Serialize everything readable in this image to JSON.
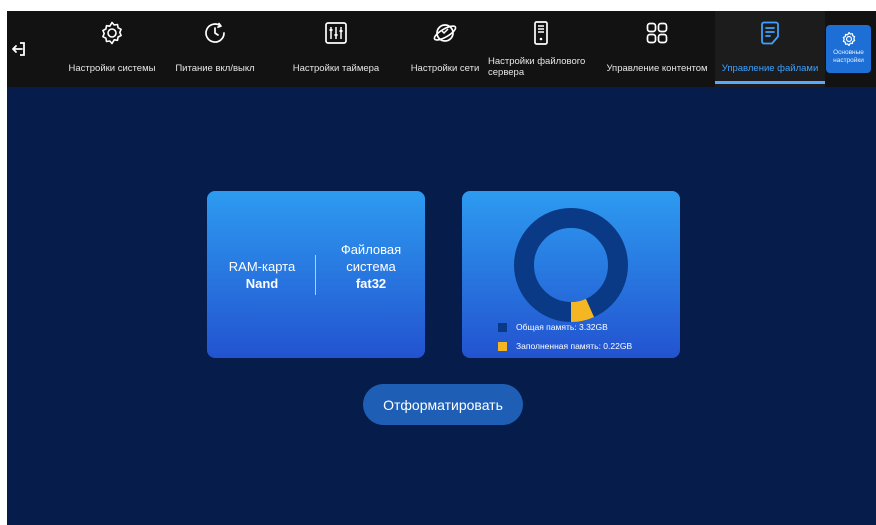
{
  "nav": {
    "tabs": [
      {
        "label": "Настройки системы",
        "icon": "gear-icon"
      },
      {
        "label": "Питание вкл/выкл",
        "icon": "power-timer-icon"
      },
      {
        "label": "Настройки таймера",
        "icon": "sliders-icon"
      },
      {
        "label": "Настройки сети",
        "icon": "network-globe-icon"
      },
      {
        "label": "Настройки файлового сервера",
        "icon": "file-server-icon"
      },
      {
        "label": "Управление контентом",
        "icon": "content-grid-icon"
      },
      {
        "label": "Управление файлами",
        "icon": "file-manage-icon",
        "active": true
      }
    ],
    "side_button": {
      "label": "Основные настройки",
      "icon": "gear-icon"
    },
    "back_icon": "exit-arrow-icon"
  },
  "storage_card": {
    "card_label": "RAM-карта",
    "card_value": "Nand",
    "fs_label": "Файловая система",
    "fs_value": "fat32"
  },
  "memory_card": {
    "total_label": "Общая память: 3.32GB",
    "used_label": "Заполненная память: 0.22GB",
    "total_gb": 3.32,
    "used_gb": 0.22,
    "colors": {
      "total": "#0a3a86",
      "used": "#f5b623"
    }
  },
  "actions": {
    "format_label": "Отформатировать"
  },
  "colors": {
    "background": "#061c4a",
    "topbar": "#121212",
    "active_tab": "#3ea0ff",
    "button": "#1e5fb5"
  }
}
